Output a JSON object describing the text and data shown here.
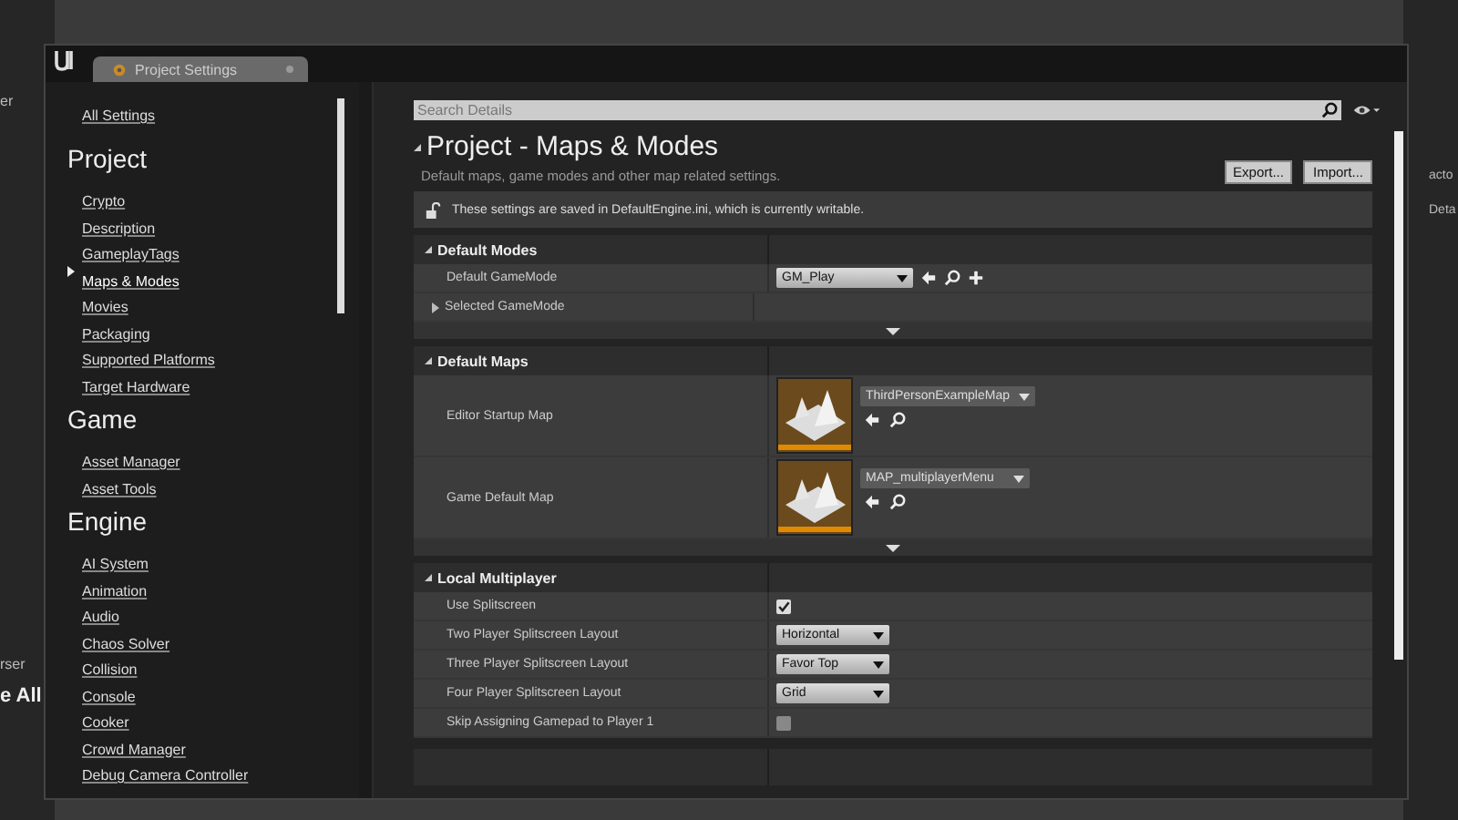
{
  "background": {
    "left_texts": [
      "er",
      "rser",
      "e All"
    ],
    "right_texts": [
      "acto",
      "Deta"
    ]
  },
  "window": {
    "tab_title": "Project Settings"
  },
  "sidebar": {
    "all_settings": "All Settings",
    "groups": [
      {
        "heading": "Project",
        "items": [
          {
            "label": "Crypto",
            "selected": false
          },
          {
            "label": "Description",
            "selected": false
          },
          {
            "label": "GameplayTags",
            "selected": false
          },
          {
            "label": "Maps & Modes",
            "selected": true
          },
          {
            "label": "Movies",
            "selected": false
          },
          {
            "label": "Packaging",
            "selected": false
          },
          {
            "label": "Supported Platforms",
            "selected": false
          },
          {
            "label": "Target Hardware",
            "selected": false
          }
        ]
      },
      {
        "heading": "Game",
        "items": [
          {
            "label": "Asset Manager",
            "selected": false
          },
          {
            "label": "Asset Tools",
            "selected": false
          }
        ]
      },
      {
        "heading": "Engine",
        "items": [
          {
            "label": "AI System",
            "selected": false
          },
          {
            "label": "Animation",
            "selected": false
          },
          {
            "label": "Audio",
            "selected": false
          },
          {
            "label": "Chaos Solver",
            "selected": false
          },
          {
            "label": "Collision",
            "selected": false
          },
          {
            "label": "Console",
            "selected": false
          },
          {
            "label": "Cooker",
            "selected": false
          },
          {
            "label": "Crowd Manager",
            "selected": false
          },
          {
            "label": "Debug Camera Controller",
            "selected": false
          }
        ]
      }
    ]
  },
  "details": {
    "search": {
      "placeholder": "Search Details"
    },
    "title": "Project - Maps & Modes",
    "subtitle": "Default maps, game modes and other map related settings.",
    "buttons": [
      "Export...",
      "Import..."
    ],
    "notice": "These settings are saved in DefaultEngine.ini, which is currently writable.",
    "sections": [
      {
        "title": "Default Modes",
        "expanded": true,
        "more": true,
        "rows": [
          {
            "kind": "class",
            "label": "Default GameMode",
            "value": "GM_Play"
          },
          {
            "kind": "expander",
            "label": "Selected GameMode",
            "expanded": false
          }
        ]
      },
      {
        "title": "Default Maps",
        "expanded": true,
        "more": true,
        "rows": [
          {
            "kind": "asset",
            "label": "Editor Startup Map",
            "value": "ThirdPersonExampleMap"
          },
          {
            "kind": "asset",
            "label": "Game Default Map",
            "value": "MAP_multiplayerMenu"
          }
        ]
      },
      {
        "title": "Local Multiplayer",
        "expanded": true,
        "rows": [
          {
            "kind": "checkbox",
            "label": "Use Splitscreen",
            "checked": true
          },
          {
            "kind": "enum",
            "label": "Two Player Splitscreen Layout",
            "value": "Horizontal"
          },
          {
            "kind": "enum",
            "label": "Three Player Splitscreen Layout",
            "value": "Favor Top"
          },
          {
            "kind": "enum",
            "label": "Four Player Splitscreen Layout",
            "value": "Grid"
          },
          {
            "kind": "checkbox",
            "label": "Skip Assigning Gamepad to Player 1",
            "checked": false
          }
        ]
      }
    ]
  }
}
